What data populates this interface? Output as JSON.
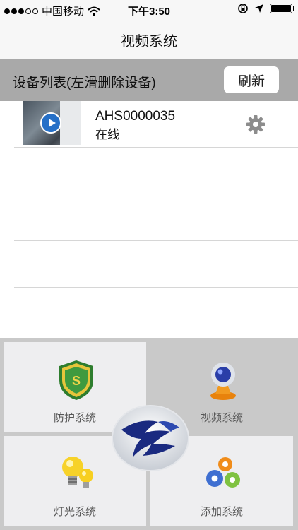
{
  "status_bar": {
    "carrier": "中国移动",
    "time": "下午3:50"
  },
  "nav": {
    "title": "视频系统"
  },
  "device_header": {
    "title": "设备列表(左滑删除设备)",
    "refresh_label": "刷新"
  },
  "devices": [
    {
      "id": "AHS0000035",
      "status": "在线"
    }
  ],
  "menu": [
    {
      "label": "防护系统",
      "icon": "shield-icon"
    },
    {
      "label": "视频系统",
      "icon": "webcam-icon"
    },
    {
      "label": "灯光系统",
      "icon": "lightbulb-icon"
    },
    {
      "label": "添加系统",
      "icon": "gears-icon"
    }
  ]
}
